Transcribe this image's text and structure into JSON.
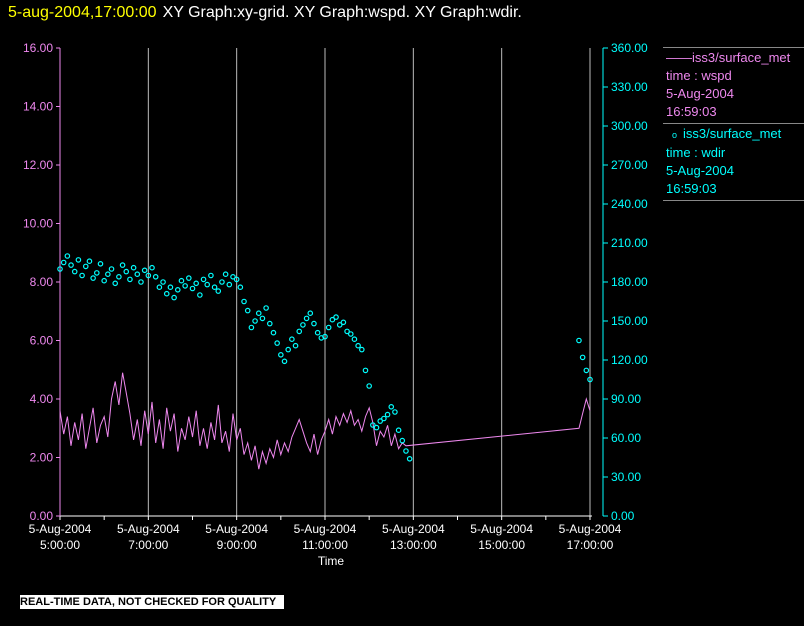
{
  "title": {
    "datetime": "5-aug-2004,17:00:00",
    "graphs": "XY Graph:xy-grid.  XY Graph:wspd.  XY Graph:wdir."
  },
  "legend": [
    {
      "symbol": "line",
      "source": "iss3/surface_met",
      "variable": "time : wspd",
      "date": "5-Aug-2004",
      "time": "16:59:03"
    },
    {
      "symbol": "circle",
      "source": "iss3/surface_met",
      "variable": "time : wdir",
      "date": "5-Aug-2004",
      "time": "16:59:03"
    }
  ],
  "quality_note": "REAL-TIME DATA, NOT CHECKED FOR QUALITY",
  "colors": {
    "wspd": "#ee88ee",
    "wdir": "#00ffff",
    "title": "#ffff00",
    "axis": "#ffffff"
  },
  "chart_data": {
    "type": "line",
    "xlabel": "Time",
    "x_range_hours": [
      5,
      17
    ],
    "x_tick_labels": [
      {
        "hour": 5,
        "date": "5-Aug-2004",
        "time": "5:00:00"
      },
      {
        "hour": 7,
        "date": "5-Aug-2004",
        "time": "7:00:00"
      },
      {
        "hour": 9,
        "date": "5-Aug-2004",
        "time": "9:00:00"
      },
      {
        "hour": 11,
        "date": "5-Aug-2004",
        "time": "11:00:00"
      },
      {
        "hour": 13,
        "date": "5-Aug-2004",
        "time": "13:00:00"
      },
      {
        "hour": 15,
        "date": "5-Aug-2004",
        "time": "15:00:00"
      },
      {
        "hour": 17,
        "date": "5-Aug-2004",
        "time": "17:00:00"
      }
    ],
    "grid": "vertical at labeled hours",
    "y_left": {
      "range": [
        0,
        16
      ],
      "ticks": [
        "0.00",
        "2.00",
        "4.00",
        "6.00",
        "8.00",
        "10.00",
        "12.00",
        "14.00",
        "16.00"
      ]
    },
    "y_right": {
      "range": [
        0,
        360
      ],
      "ticks": [
        "0.00",
        "30.00",
        "60.00",
        "90.00",
        "120.00",
        "150.00",
        "180.00",
        "210.00",
        "240.00",
        "270.00",
        "300.00",
        "330.00",
        "360.00"
      ]
    },
    "series": [
      {
        "name": "wspd",
        "axis": "left",
        "style": "line",
        "segments": [
          {
            "start_hour": 5,
            "step_min": 5,
            "values": [
              3.6,
              2.8,
              3.4,
              2.4,
              3.2,
              2.6,
              3.5,
              2.3,
              3.0,
              3.7,
              2.5,
              3.1,
              3.4,
              2.7,
              4.0,
              4.6,
              3.8,
              4.9,
              4.2,
              3.5,
              2.6,
              3.3,
              2.4,
              3.6,
              2.8,
              3.9,
              2.5,
              3.3,
              2.3,
              3.7,
              2.9,
              3.5,
              2.2,
              3.0,
              2.6,
              3.4,
              2.7,
              3.6,
              2.4,
              3.0,
              2.3,
              3.2,
              2.6,
              3.8,
              2.5,
              2.9,
              2.2,
              3.5,
              2.6,
              3.0,
              2.1,
              2.5,
              1.9,
              2.4,
              1.6,
              2.2,
              1.8,
              2.3,
              2.0,
              2.6,
              2.1,
              2.5,
              2.2,
              2.7,
              3.0,
              3.3,
              2.9,
              2.5,
              2.2,
              2.8,
              2.1,
              2.6,
              2.9,
              3.3,
              2.8,
              3.4,
              3.1,
              3.5,
              3.2,
              3.6,
              3.1,
              3.3,
              2.9,
              3.4,
              3.7,
              3.2,
              2.4,
              2.9,
              2.7,
              3.1,
              2.4,
              2.8,
              2.3,
              2.5,
              2.4
            ]
          },
          {
            "start_hour": 16.75,
            "step_min": 5,
            "values": [
              3.0,
              3.5,
              4.0,
              3.6
            ]
          }
        ]
      },
      {
        "name": "wdir",
        "axis": "right",
        "style": "circles",
        "segments": [
          {
            "start_hour": 5,
            "step_min": 5,
            "values": [
              190,
              195,
              200,
              193,
              188,
              197,
              185,
              192,
              196,
              183,
              187,
              194,
              181,
              186,
              190,
              179,
              184,
              193,
              188,
              182,
              191,
              186,
              180,
              189,
              185,
              191,
              184,
              176,
              180,
              171,
              176,
              168,
              174,
              181,
              177,
              183,
              175,
              179,
              170,
              182,
              178,
              185,
              176,
              173,
              180,
              186,
              178,
              184,
              182,
              176,
              165,
              158,
              145,
              150,
              156,
              152,
              160,
              148,
              141,
              133,
              124,
              119,
              128,
              136,
              131,
              142,
              147,
              152,
              156,
              148,
              141,
              137,
              138,
              145,
              151,
              153,
              147,
              149,
              142,
              140,
              136,
              131,
              128,
              112,
              100,
              70,
              68,
              73,
              75,
              78,
              84,
              80,
              66,
              58,
              50,
              44
            ]
          },
          {
            "start_hour": 16.75,
            "step_min": 5,
            "values": [
              135,
              122,
              112,
              105
            ]
          }
        ]
      }
    ]
  }
}
